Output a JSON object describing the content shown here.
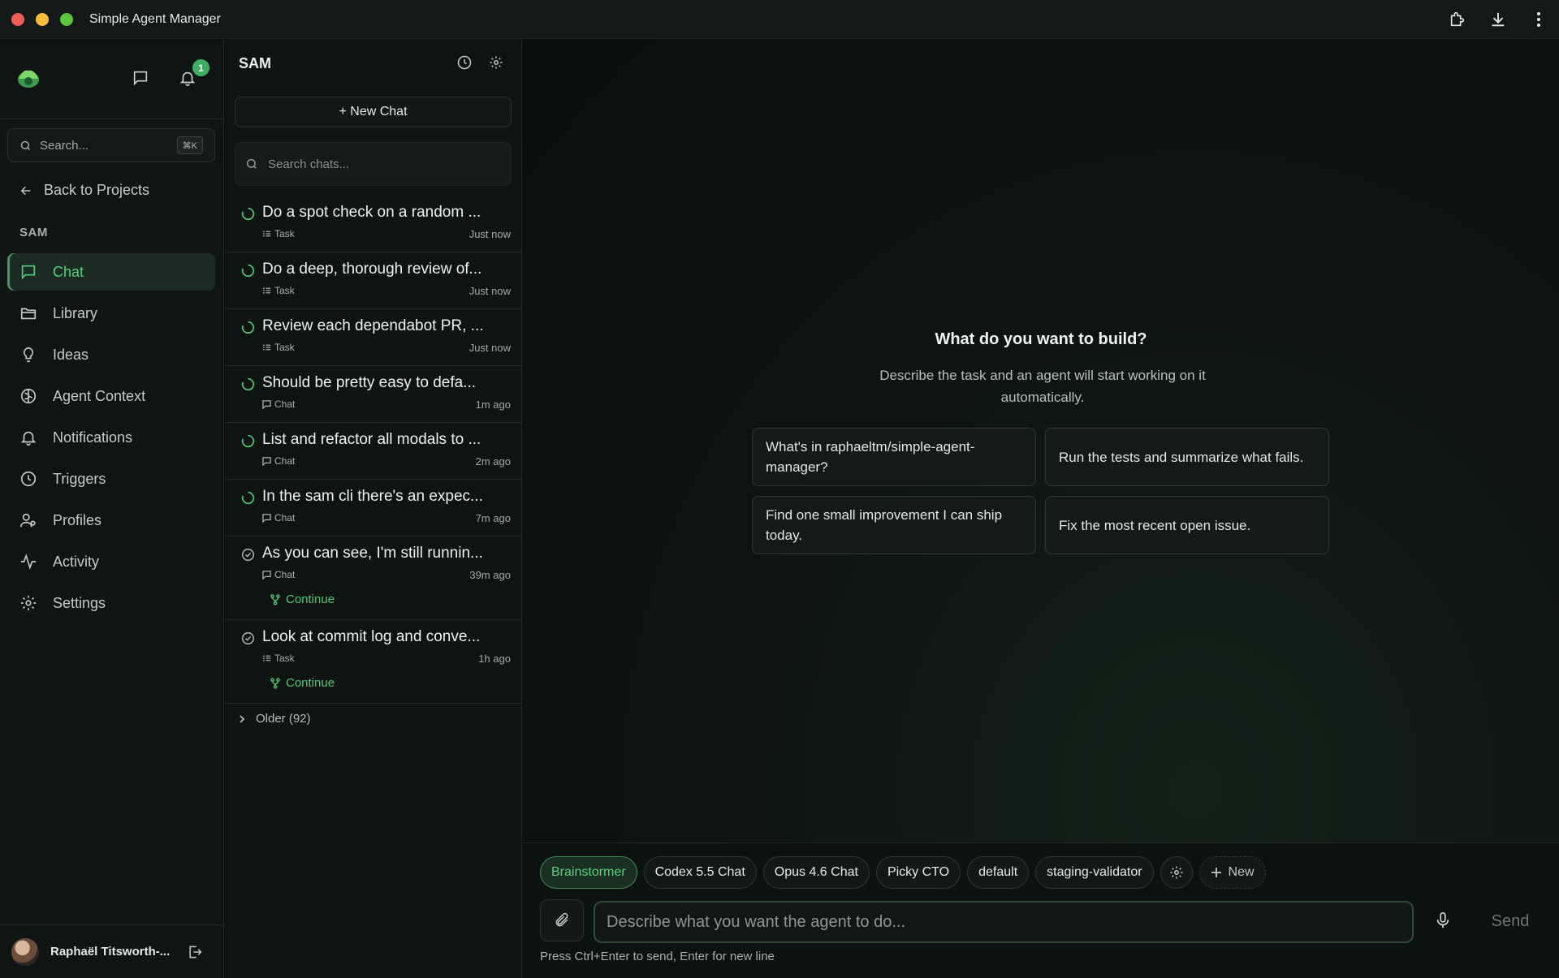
{
  "window": {
    "title": "Simple Agent Manager"
  },
  "sidebar": {
    "notification_count": "1",
    "search_placeholder": "Search...",
    "search_shortcut": "⌘K",
    "back_label": "Back to Projects",
    "project_label": "SAM",
    "items": [
      {
        "label": "Chat",
        "icon": "chat-icon",
        "active": true
      },
      {
        "label": "Library",
        "icon": "folder-icon"
      },
      {
        "label": "Ideas",
        "icon": "lightbulb-icon"
      },
      {
        "label": "Agent Context",
        "icon": "brain-icon"
      },
      {
        "label": "Notifications",
        "icon": "bell-icon"
      },
      {
        "label": "Triggers",
        "icon": "clock-icon"
      },
      {
        "label": "Profiles",
        "icon": "profiles-icon"
      },
      {
        "label": "Activity",
        "icon": "activity-icon"
      },
      {
        "label": "Settings",
        "icon": "gear-icon"
      }
    ],
    "user_name": "Raphaël Titsworth-..."
  },
  "chat_list": {
    "title": "SAM",
    "new_chat_label": "+ New Chat",
    "search_placeholder": "Search chats...",
    "items": [
      {
        "title": "Do a spot check on a random ...",
        "type": "Task",
        "time": "Just now",
        "status": "running"
      },
      {
        "title": "Do a deep, thorough review of...",
        "type": "Task",
        "time": "Just now",
        "status": "running"
      },
      {
        "title": "Review each dependabot PR, ...",
        "type": "Task",
        "time": "Just now",
        "status": "running"
      },
      {
        "title": "Should be pretty easy to defa...",
        "type": "Chat",
        "time": "1m ago",
        "status": "running"
      },
      {
        "title": "List and refactor all modals to ...",
        "type": "Chat",
        "time": "2m ago",
        "status": "running"
      },
      {
        "title": "In the sam cli there's an expec...",
        "type": "Chat",
        "time": "7m ago",
        "status": "running"
      },
      {
        "title": "As you can see, I'm still runnin...",
        "type": "Chat",
        "time": "39m ago",
        "status": "done",
        "action": "Continue"
      },
      {
        "title": "Look at commit log and conve...",
        "type": "Task",
        "time": "1h ago",
        "status": "done",
        "action": "Continue"
      }
    ],
    "older_label": "Older (92)"
  },
  "main": {
    "title": "What do you want to build?",
    "subtitle": "Describe the task and an agent will start working on it automatically.",
    "suggestions": [
      "What's in raphaeltm/simple-agent-manager?",
      "Run the tests and summarize what fails.",
      "Find one small improvement I can ship today.",
      "Fix the most recent open issue."
    ],
    "profiles": [
      "Brainstormer",
      "Codex 5.5 Chat",
      "Opus 4.6 Chat",
      "Picky CTO",
      "default",
      "staging-validator"
    ],
    "new_profile_label": "New",
    "input_placeholder": "Describe what you want the agent to do...",
    "send_label": "Send",
    "hint": "Press Ctrl+Enter to send, Enter for new line"
  },
  "colors": {
    "accent": "#4fc873",
    "background": "#0b0f0d"
  }
}
